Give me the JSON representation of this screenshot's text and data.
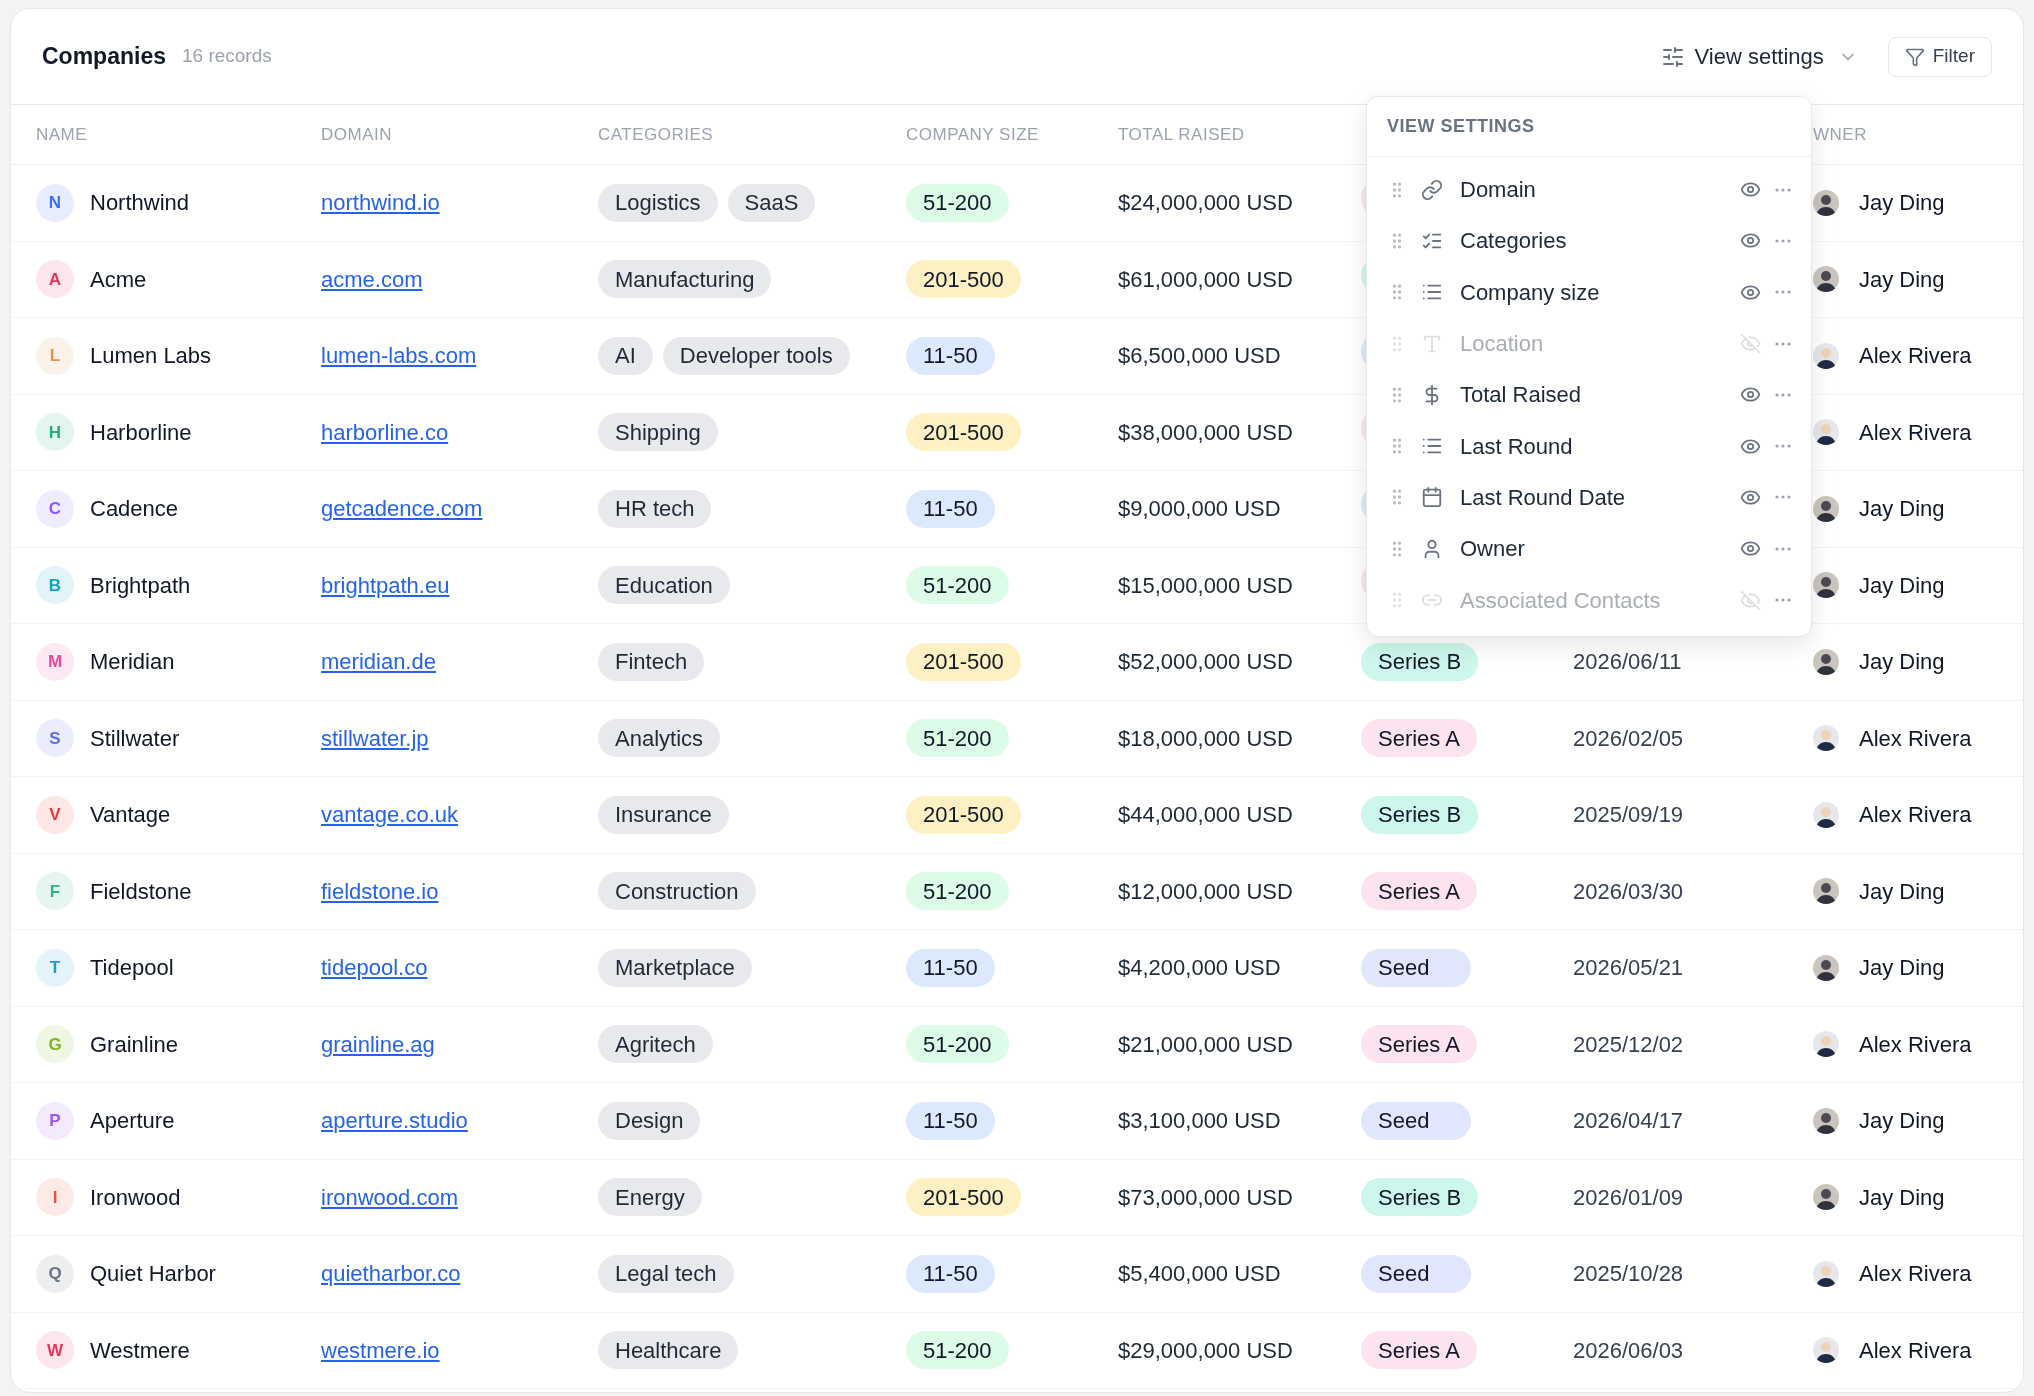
{
  "header": {
    "title": "Companies",
    "count": "16 records",
    "view_settings": "View settings",
    "filter": "Filter"
  },
  "columns": [
    "NAME",
    "DOMAIN",
    "CATEGORIES",
    "COMPANY SIZE",
    "TOTAL RAISED",
    "WNER"
  ],
  "rows": [
    {
      "initial": "N",
      "color": "#3b6ff5",
      "name": "Northwind",
      "domain": "northwind.io",
      "categories": [
        "Logistics",
        "SaaS"
      ],
      "size": {
        "label": "51-200",
        "kind": "green"
      },
      "raised": "$24,000,000 USD",
      "round": {
        "kind": "pink"
      },
      "owner": {
        "name": "Jay Ding",
        "kind": "dark"
      }
    },
    {
      "initial": "A",
      "color": "#e8345a",
      "name": "Acme",
      "domain": "acme.com",
      "categories": [
        "Manufacturing"
      ],
      "size": {
        "label": "201-500",
        "kind": "yellow"
      },
      "raised": "$61,000,000 USD",
      "round": {
        "kind": "teal"
      },
      "owner": {
        "name": "Jay Ding",
        "kind": "dark"
      }
    },
    {
      "initial": "L",
      "color": "#e0914a",
      "name": "Lumen Labs",
      "domain": "lumen-labs.com",
      "categories": [
        "AI",
        "Developer tools"
      ],
      "size": {
        "label": "11-50",
        "kind": "blue"
      },
      "raised": "$6,500,000 USD",
      "round": {
        "kind": "indigo"
      },
      "owner": {
        "name": "Alex Rivera",
        "kind": "light"
      }
    },
    {
      "initial": "H",
      "color": "#22b07d",
      "name": "Harborline",
      "domain": "harborline.co",
      "categories": [
        "Shipping"
      ],
      "size": {
        "label": "201-500",
        "kind": "yellow"
      },
      "raised": "$38,000,000 USD",
      "round": {
        "kind": "pink"
      },
      "owner": {
        "name": "Alex Rivera",
        "kind": "light"
      }
    },
    {
      "initial": "C",
      "color": "#8b5cf6",
      "name": "Cadence",
      "domain": "getcadence.com",
      "categories": [
        "HR tech"
      ],
      "size": {
        "label": "11-50",
        "kind": "blue"
      },
      "raised": "$9,000,000 USD",
      "round": {
        "kind": "indigo"
      },
      "owner": {
        "name": "Jay Ding",
        "kind": "dark"
      }
    },
    {
      "initial": "B",
      "color": "#0ea5c6",
      "name": "Brightpath",
      "domain": "brightpath.eu",
      "categories": [
        "Education"
      ],
      "size": {
        "label": "51-200",
        "kind": "green"
      },
      "raised": "$15,000,000 USD",
      "round": {
        "kind": "pink"
      },
      "owner": {
        "name": "Jay Ding",
        "kind": "dark"
      }
    },
    {
      "initial": "M",
      "color": "#ec4899",
      "name": "Meridian",
      "domain": "meridian.de",
      "categories": [
        "Fintech"
      ],
      "size": {
        "label": "201-500",
        "kind": "yellow"
      },
      "raised": "$52,000,000 USD",
      "round": {
        "label": "Series B",
        "kind": "teal"
      },
      "date": "2026/06/11",
      "owner": {
        "name": "Jay Ding",
        "kind": "dark"
      }
    },
    {
      "initial": "S",
      "color": "#5b6ee8",
      "name": "Stillwater",
      "domain": "stillwater.jp",
      "categories": [
        "Analytics"
      ],
      "size": {
        "label": "51-200",
        "kind": "green"
      },
      "raised": "$18,000,000 USD",
      "round": {
        "label": "Series A",
        "kind": "pink"
      },
      "date": "2026/02/05",
      "owner": {
        "name": "Alex Rivera",
        "kind": "light"
      }
    },
    {
      "initial": "V",
      "color": "#e53935",
      "name": "Vantage",
      "domain": "vantage.co.uk",
      "categories": [
        "Insurance"
      ],
      "size": {
        "label": "201-500",
        "kind": "yellow"
      },
      "raised": "$44,000,000 USD",
      "round": {
        "label": "Series B",
        "kind": "teal"
      },
      "date": "2025/09/19",
      "owner": {
        "name": "Alex Rivera",
        "kind": "light"
      }
    },
    {
      "initial": "F",
      "color": "#2bb58a",
      "name": "Fieldstone",
      "domain": "fieldstone.io",
      "categories": [
        "Construction"
      ],
      "size": {
        "label": "51-200",
        "kind": "green"
      },
      "raised": "$12,000,000 USD",
      "round": {
        "label": "Series A",
        "kind": "pink"
      },
      "date": "2026/03/30",
      "owner": {
        "name": "Jay Ding",
        "kind": "dark"
      }
    },
    {
      "initial": "T",
      "color": "#1e9bd7",
      "name": "Tidepool",
      "domain": "tidepool.co",
      "categories": [
        "Marketplace"
      ],
      "size": {
        "label": "11-50",
        "kind": "blue"
      },
      "raised": "$4,200,000 USD",
      "round": {
        "label": "Seed",
        "kind": "indigo"
      },
      "date": "2026/05/21",
      "owner": {
        "name": "Jay Ding",
        "kind": "dark"
      }
    },
    {
      "initial": "G",
      "color": "#7cb518",
      "name": "Grainline",
      "domain": "grainline.ag",
      "categories": [
        "Agritech"
      ],
      "size": {
        "label": "51-200",
        "kind": "green"
      },
      "raised": "$21,000,000 USD",
      "round": {
        "label": "Series A",
        "kind": "pink"
      },
      "date": "2025/12/02",
      "owner": {
        "name": "Alex Rivera",
        "kind": "light"
      }
    },
    {
      "initial": "P",
      "color": "#9b59f0",
      "name": "Aperture",
      "domain": "aperture.studio",
      "categories": [
        "Design"
      ],
      "size": {
        "label": "11-50",
        "kind": "blue"
      },
      "raised": "$3,100,000 USD",
      "round": {
        "label": "Seed",
        "kind": "indigo"
      },
      "date": "2026/04/17",
      "owner": {
        "name": "Jay Ding",
        "kind": "dark"
      }
    },
    {
      "initial": "I",
      "color": "#e8533a",
      "name": "Ironwood",
      "domain": "ironwood.com",
      "categories": [
        "Energy"
      ],
      "size": {
        "label": "201-500",
        "kind": "yellow"
      },
      "raised": "$73,000,000 USD",
      "round": {
        "label": "Series B",
        "kind": "teal"
      },
      "date": "2026/01/09",
      "owner": {
        "name": "Jay Ding",
        "kind": "dark"
      }
    },
    {
      "initial": "Q",
      "color": "#6b7280",
      "name": "Quiet Harbor",
      "domain": "quietharbor.co",
      "categories": [
        "Legal tech"
      ],
      "size": {
        "label": "11-50",
        "kind": "blue"
      },
      "raised": "$5,400,000 USD",
      "round": {
        "label": "Seed",
        "kind": "indigo"
      },
      "date": "2025/10/28",
      "owner": {
        "name": "Alex Rivera",
        "kind": "light"
      }
    },
    {
      "initial": "W",
      "color": "#e8345a",
      "name": "Westmere",
      "domain": "westmere.io",
      "categories": [
        "Healthcare"
      ],
      "size": {
        "label": "51-200",
        "kind": "green"
      },
      "raised": "$29,000,000 USD",
      "round": {
        "label": "Series A",
        "kind": "pink"
      },
      "date": "2026/06/03",
      "owner": {
        "name": "Alex Rivera",
        "kind": "light"
      }
    }
  ],
  "view_settings_menu": {
    "title": "VIEW SETTINGS",
    "fields": [
      {
        "label": "Domain",
        "kind": "link",
        "visible": true
      },
      {
        "label": "Categories",
        "kind": "checklist",
        "visible": true
      },
      {
        "label": "Company size",
        "kind": "list",
        "visible": true
      },
      {
        "label": "Location",
        "kind": "text",
        "visible": false
      },
      {
        "label": "Total Raised",
        "kind": "currency",
        "visible": true
      },
      {
        "label": "Last Round",
        "kind": "list",
        "visible": true
      },
      {
        "label": "Last Round Date",
        "kind": "date",
        "visible": true
      },
      {
        "label": "Owner",
        "kind": "person",
        "visible": true
      },
      {
        "label": "Associated Contacts",
        "kind": "relation",
        "visible": false
      }
    ]
  }
}
